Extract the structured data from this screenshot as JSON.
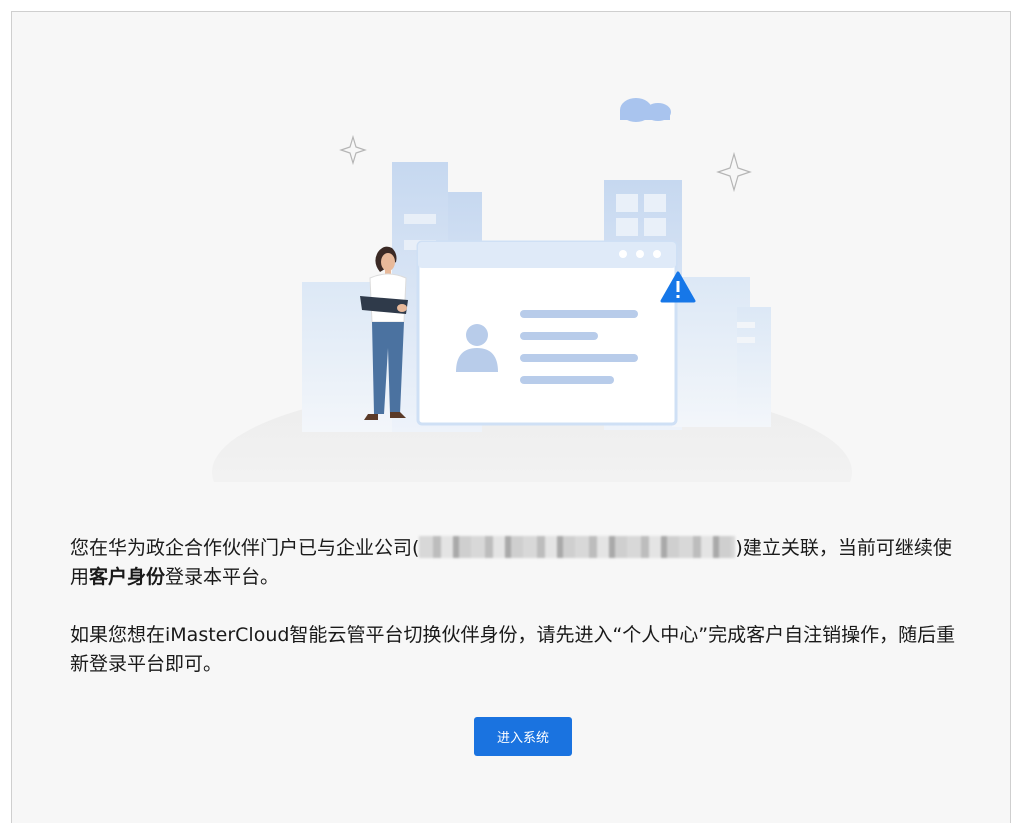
{
  "notice": {
    "line1_prefix": "您在华为政企合作伙伴门户已与企业公司(",
    "line1_suffix": ")建立关联，当前可继续使用",
    "identity_bold": "客户身份",
    "line1_end": "登录本平台。",
    "line2": "如果您想在iMasterCloud智能云管平台切换伙伴身份，请先进入“个人中心”完成客户自注销操作，随后重新登录平台即可。"
  },
  "actions": {
    "enter_label": "进入系统",
    "button_color": "#1a73e0"
  },
  "colors": {
    "warning": "#1677e8",
    "building": "#c9daf0"
  }
}
